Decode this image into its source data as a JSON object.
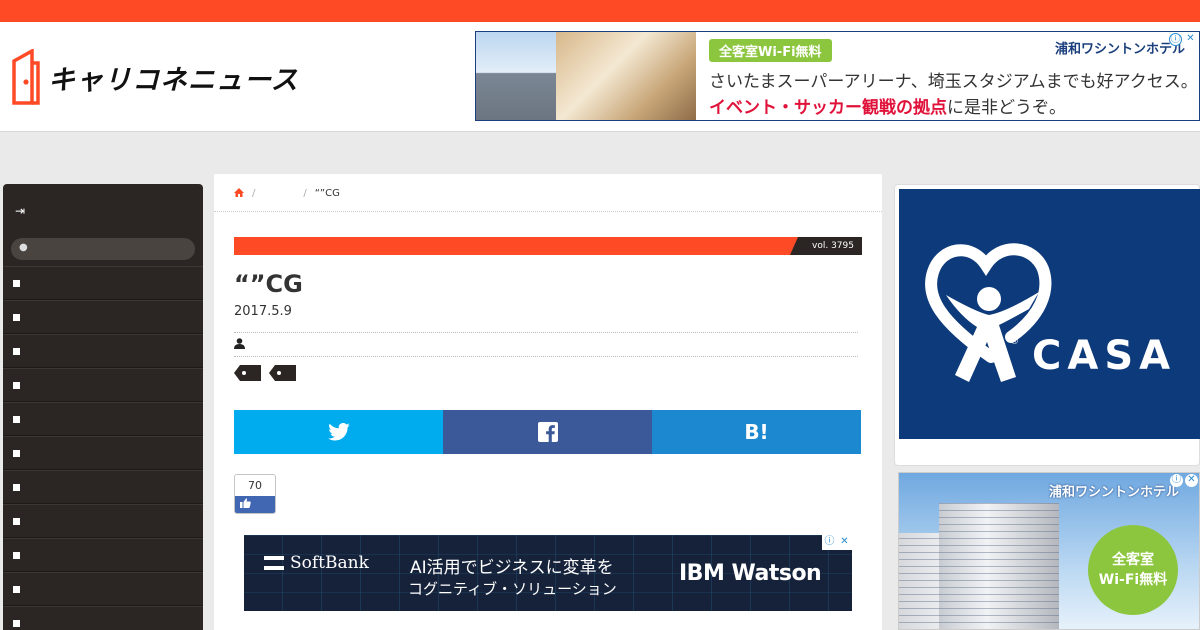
{
  "site": {
    "logo_text": "キャリコネニュース",
    "brand_color": "#ff4a26"
  },
  "top_ad": {
    "badge": "全客室Wi-Fi無料",
    "hotel_name": "浦和ワシントンホテル",
    "line1": "さいたまスーパーアリーナ、埼玉スタジアムまでも好アクセス。",
    "line2_highlight": "イベント・サッカー観戦の拠点",
    "line2_rest": "に是非どうぞ。",
    "adchoice_icon": "ⓘ",
    "close_icon": "✕"
  },
  "sidebar": {
    "login_icon": "⇥",
    "search_icon": "🔍",
    "search_placeholder": "",
    "item_count_shown": 11
  },
  "article": {
    "breadcrumb_sep": "/",
    "breadcrumb_current": "“”CG",
    "vol_label": "vol. 3795",
    "title": "“”CG",
    "date": "2017.5.9",
    "author_icon": "person-icon",
    "share": {
      "twitter_icon": "twitter-icon",
      "facebook_icon": "facebook-icon",
      "hatena_label": "B!"
    },
    "like_count": "70"
  },
  "inline_ad": {
    "brand": "SoftBank",
    "copy1": "AI活用でビジネスに変革を",
    "copy2": "コグニティブ・ソリューション",
    "product": "IBM Watson"
  },
  "right_ads": {
    "casa_text": "CASA",
    "hotel_name": "浦和ワシントンホテル",
    "circle_line1": "全客室",
    "circle_line2": "Wi-Fi無料"
  }
}
